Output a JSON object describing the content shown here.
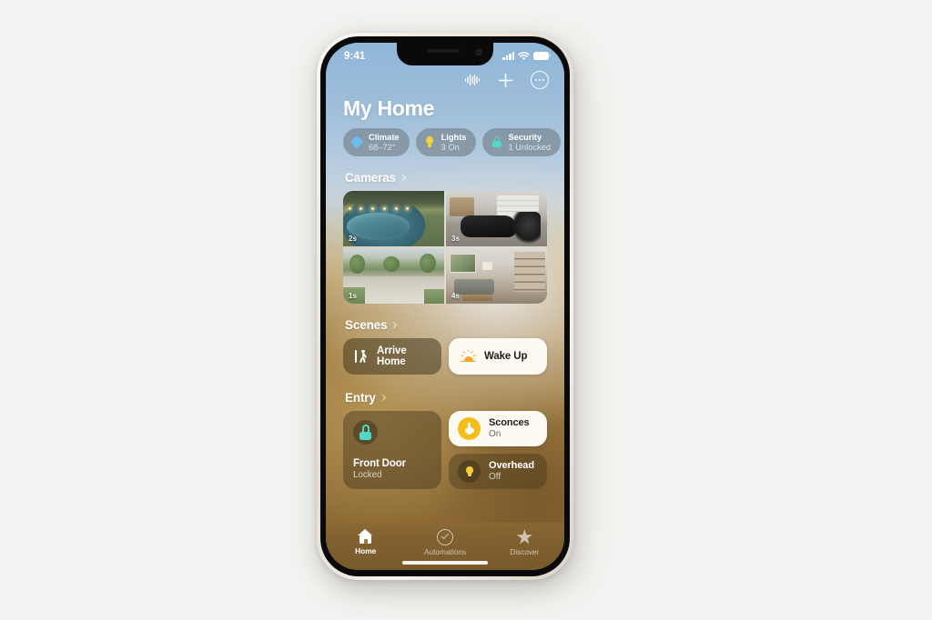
{
  "device": {
    "status_bar": {
      "time": "9:41",
      "cellular_icon": "signal-bars-icon",
      "wifi_icon": "wifi-icon",
      "battery_icon": "battery-icon"
    },
    "home_indicator": "home-indicator"
  },
  "app": {
    "title": "My Home",
    "header_actions": [
      {
        "name": "siri-waveform-icon",
        "label": "Siri"
      },
      {
        "name": "add-icon",
        "label": "Add"
      },
      {
        "name": "more-icon",
        "label": "More"
      }
    ]
  },
  "status_chips": [
    {
      "icon": "fan-icon",
      "title": "Climate",
      "subtitle": "68–72°",
      "accent": "#6fbdf0"
    },
    {
      "icon": "bulb-icon",
      "title": "Lights",
      "subtitle": "3 On",
      "accent": "#f5cf38"
    },
    {
      "icon": "lock-icon",
      "title": "Security",
      "subtitle": "1 Unlocked",
      "accent": "#4fd8c8"
    }
  ],
  "sections": {
    "cameras": {
      "title": "Cameras",
      "chevron": "chevron-right-icon",
      "tiles": [
        {
          "name": "camera-pool",
          "badge": "2s"
        },
        {
          "name": "camera-garage-gym",
          "badge": "3s"
        },
        {
          "name": "camera-driveway",
          "badge": "1s"
        },
        {
          "name": "camera-living-room",
          "badge": "4s"
        }
      ]
    },
    "scenes": {
      "title": "Scenes",
      "chevron": "chevron-right-icon",
      "cards": [
        {
          "icon": "walking-person-icon",
          "label": "Arrive Home",
          "state": "off"
        },
        {
          "icon": "sunrise-icon",
          "label": "Wake Up",
          "state": "on"
        }
      ]
    },
    "entry": {
      "title": "Entry",
      "chevron": "chevron-right-icon",
      "front_door": {
        "icon": "lock-closed-icon",
        "title": "Front Door",
        "subtitle": "Locked",
        "accent": "#4fd8c8"
      },
      "lights": [
        {
          "icon": "sconce-icon",
          "title": "Sconces",
          "subtitle": "On",
          "state": "on"
        },
        {
          "icon": "overhead-icon",
          "title": "Overhead",
          "subtitle": "Off",
          "state": "off"
        }
      ]
    }
  },
  "tab_bar": [
    {
      "icon": "house-icon",
      "label": "Home",
      "active": true
    },
    {
      "icon": "check-circle-icon",
      "label": "Automations",
      "active": false
    },
    {
      "icon": "star-icon",
      "label": "Discover",
      "active": false
    }
  ]
}
